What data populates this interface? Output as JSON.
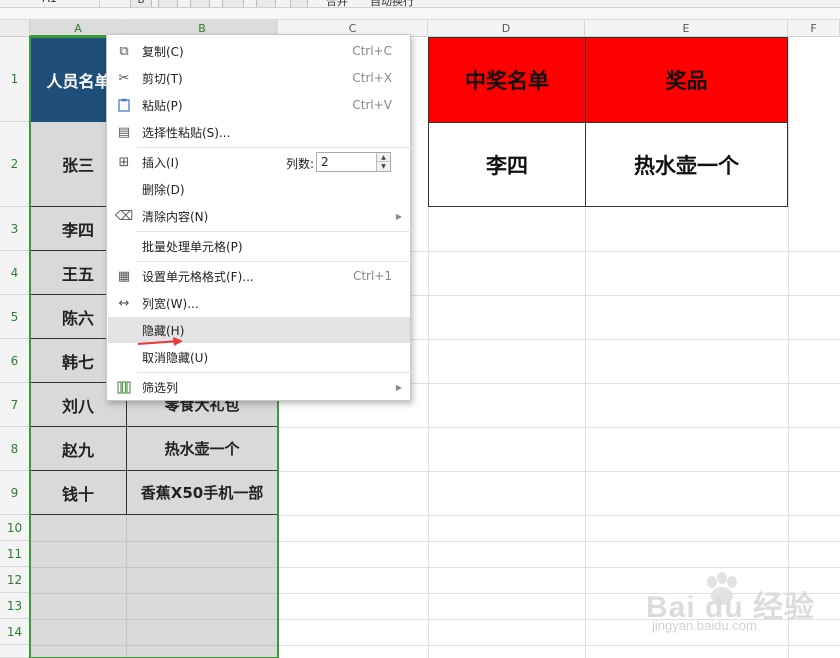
{
  "toolbar": {
    "namebox": "A1",
    "bold_label": "B",
    "merge_label": "合并",
    "autowrap_label": "自动换行"
  },
  "columns": [
    "A",
    "B",
    "C",
    "D",
    "E",
    "F"
  ],
  "rows": [
    "1",
    "2",
    "3",
    "4",
    "5",
    "6",
    "7",
    "8",
    "9",
    "10",
    "11",
    "12",
    "13",
    "14"
  ],
  "table_a": {
    "header": "人员名单",
    "names": [
      "张三",
      "李四",
      "王五",
      "陈六",
      "韩七",
      "刘八",
      "赵九",
      "钱十"
    ]
  },
  "table_b": {
    "prizes_visible": [
      "零食大礼包",
      "热水壶一个",
      "香蕉X50手机一部"
    ]
  },
  "winner_table": {
    "header_name": "中奖名单",
    "header_prize": "奖品",
    "name": "李四",
    "prize": "热水壶一个"
  },
  "context_menu": {
    "items": [
      {
        "label": "复制(C)",
        "shortcut": "Ctrl+C",
        "icon": "copy-icon",
        "glyph": "⧉"
      },
      {
        "label": "剪切(T)",
        "shortcut": "Ctrl+X",
        "icon": "scissors-icon",
        "glyph": "✂"
      },
      {
        "label": "粘贴(P)",
        "shortcut": "Ctrl+V",
        "icon": "paste-icon",
        "glyph": "📋"
      },
      {
        "label": "选择性粘贴(S)...",
        "shortcut": "",
        "icon": "paste-special-icon",
        "glyph": "▤"
      },
      {
        "label": "插入(I)",
        "shortcut": "",
        "icon": "insert-icon",
        "glyph": "⊞"
      },
      {
        "label": "删除(D)",
        "shortcut": "",
        "icon": "",
        "glyph": ""
      },
      {
        "label": "清除内容(N)",
        "shortcut": "",
        "icon": "eraser-icon",
        "glyph": "⌫"
      },
      {
        "label": "批量处理单元格(P)",
        "shortcut": "",
        "icon": "",
        "glyph": ""
      },
      {
        "label": "设置单元格格式(F)...",
        "shortcut": "Ctrl+1",
        "icon": "format-cells-icon",
        "glyph": "▦"
      },
      {
        "label": "列宽(W)...",
        "shortcut": "",
        "icon": "column-width-icon",
        "glyph": "↔"
      },
      {
        "label": "隐藏(H)",
        "shortcut": "",
        "icon": "",
        "glyph": ""
      },
      {
        "label": "取消隐藏(U)",
        "shortcut": "",
        "icon": "",
        "glyph": ""
      },
      {
        "label": "筛选列",
        "shortcut": "",
        "icon": "filter-columns-icon",
        "glyph": "▥"
      }
    ],
    "insert_count_label": "列数:",
    "insert_count_value": "2"
  },
  "watermark": {
    "main": "Bai du 经验",
    "sub": "jingyan.baidu.com"
  },
  "colors": {
    "selection_green": "#3a9b3a",
    "header_blue": "#1f4e79",
    "header_red": "#ff0000",
    "annotation_arrow": "#e53935"
  }
}
